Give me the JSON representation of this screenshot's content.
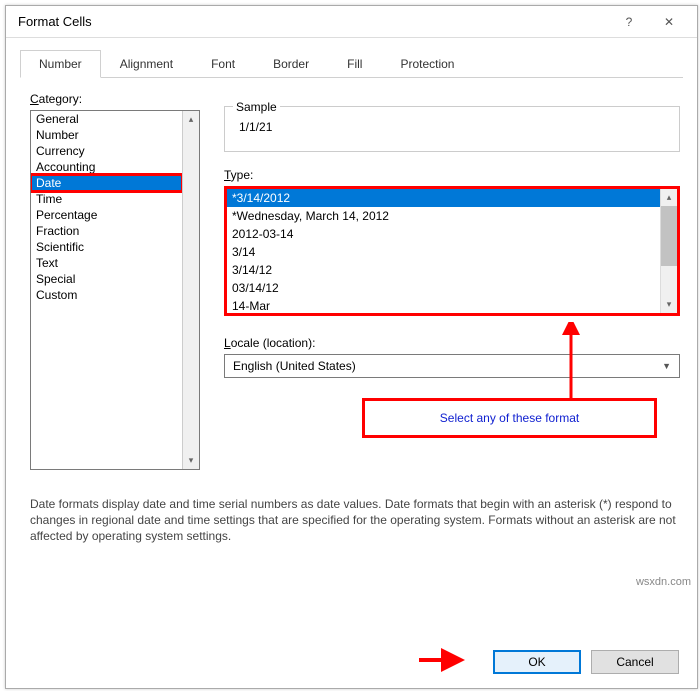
{
  "dialog": {
    "title": "Format Cells",
    "help_icon": "?",
    "close_icon": "✕"
  },
  "tabs": [
    "Number",
    "Alignment",
    "Font",
    "Border",
    "Fill",
    "Protection"
  ],
  "active_tab": "Number",
  "category": {
    "label": "Category:",
    "items": [
      "General",
      "Number",
      "Currency",
      "Accounting",
      "Date",
      "Time",
      "Percentage",
      "Fraction",
      "Scientific",
      "Text",
      "Special",
      "Custom"
    ],
    "selected": "Date"
  },
  "sample": {
    "label": "Sample",
    "value": "1/1/21"
  },
  "type": {
    "label": "Type:",
    "items": [
      "*3/14/2012",
      "*Wednesday, March 14, 2012",
      "2012-03-14",
      "3/14",
      "3/14/12",
      "03/14/12",
      "14-Mar"
    ],
    "selected": "*3/14/2012"
  },
  "locale": {
    "label": "Locale (location):",
    "value": "English (United States)"
  },
  "annotation": {
    "text": "Select any of these format"
  },
  "description": "Date formats display date and time serial numbers as date values. Date formats that begin with an asterisk (*) respond to changes in regional date and time settings that are specified for the operating system. Formats without an asterisk are not affected by operating system settings.",
  "buttons": {
    "ok": "OK",
    "cancel": "Cancel"
  },
  "watermark": "wsxdn.com"
}
